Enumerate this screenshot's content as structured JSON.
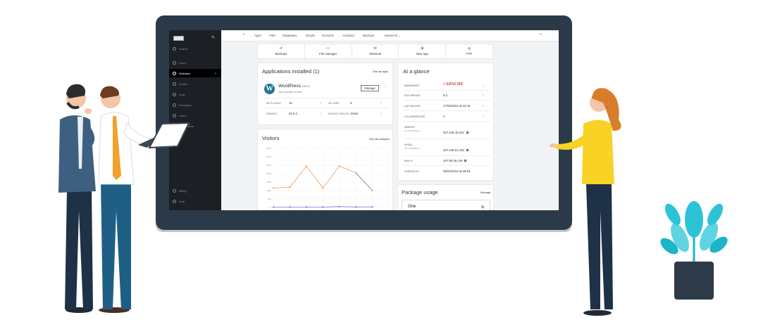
{
  "sidebar": {
    "items": [
      {
        "label": "Search",
        "icon": "search-icon"
      },
      {
        "label": "Home",
        "icon": "home-icon"
      },
      {
        "label": "Websites",
        "icon": "globe-icon",
        "active": true
      },
      {
        "label": "Emails",
        "icon": "mail-icon"
      },
      {
        "label": "Logs",
        "icon": "logs-icon"
      },
      {
        "label": "Packages",
        "icon": "package-icon"
      },
      {
        "label": "Users",
        "icon": "users-icon"
      },
      {
        "label": "Ecommerce",
        "icon": "cart-icon"
      },
      {
        "label": "Billing",
        "icon": "billing-icon"
      },
      {
        "label": "Help",
        "icon": "help-icon"
      }
    ]
  },
  "topnav": {
    "items": [
      "Apps",
      "Files",
      "Databases",
      "Emails",
      "Domains",
      "Analytics",
      "Backups",
      "Advanced"
    ]
  },
  "quick_actions": {
    "items": [
      {
        "label": "Backups",
        "icon": "restore-icon"
      },
      {
        "label": "File manager",
        "icon": "folder-icon"
      },
      {
        "label": "Webmail",
        "icon": "mail-icon"
      },
      {
        "label": "New app",
        "icon": "plus-box-icon"
      },
      {
        "label": "FTP",
        "icon": "ftp-icon"
      }
    ]
  },
  "apps": {
    "title": "Applications installed (1)",
    "see_all": "See all apps",
    "app_name": "WordPress",
    "app_version": "v6.5.3",
    "app_url": "https://jlycat5yr.website",
    "manage": "Manage",
    "rows": [
      [
        {
          "label": "WP plugins",
          "value": "10"
        },
        {
          "label": "WP user",
          "value": "5"
        }
      ],
      [
        {
          "label": "Version",
          "value": "v6.5.3"
        },
        {
          "label": "Default sign on",
          "value": "Jamie"
        }
      ]
    ]
  },
  "visitors": {
    "title": "Visitors",
    "see_all": "See all analytics"
  },
  "chart_data": {
    "type": "line",
    "title": "Visitors",
    "yticks": [
      "3500",
      "3000",
      "2500",
      "2000",
      "1500",
      "1000",
      "500",
      "0"
    ],
    "ylim": [
      0,
      3500
    ],
    "x": [
      1,
      2,
      3,
      4,
      5,
      6,
      7,
      8
    ],
    "series": [
      {
        "color": "#f29b5e",
        "values": [
          1150,
          1200,
          2450,
          1150,
          2450,
          2050,
          1000,
          null
        ]
      },
      {
        "color": "#7b6fe0",
        "values": [
          20,
          20,
          20,
          20,
          50,
          30,
          30,
          null
        ]
      }
    ]
  },
  "glance": {
    "title": "At a glance",
    "rows": [
      {
        "label": "Webserver",
        "value": "APACHE",
        "arrow": true
      },
      {
        "label": "PHP version",
        "value": "8.3",
        "arrow": true
      },
      {
        "label": "Last backup",
        "value": "17/05/2024 at 10:42",
        "arrow": true
      },
      {
        "label": "Collaborators",
        "value": "4",
        "arrow": true
      },
      {
        "label": "Website",
        "sub": "IPv4 address",
        "value": "037.245.46.241"
      },
      {
        "label": "MySQL",
        "sub": "IPv4 address",
        "value": "037.245.61.152"
      },
      {
        "label": "Mail IP",
        "value": "347.99.36.149"
      },
      {
        "label": "Created at",
        "value": "05/04/2023 at 09:53"
      }
    ]
  },
  "package": {
    "title": "Package usage",
    "manage": "Manage",
    "name": "One"
  }
}
